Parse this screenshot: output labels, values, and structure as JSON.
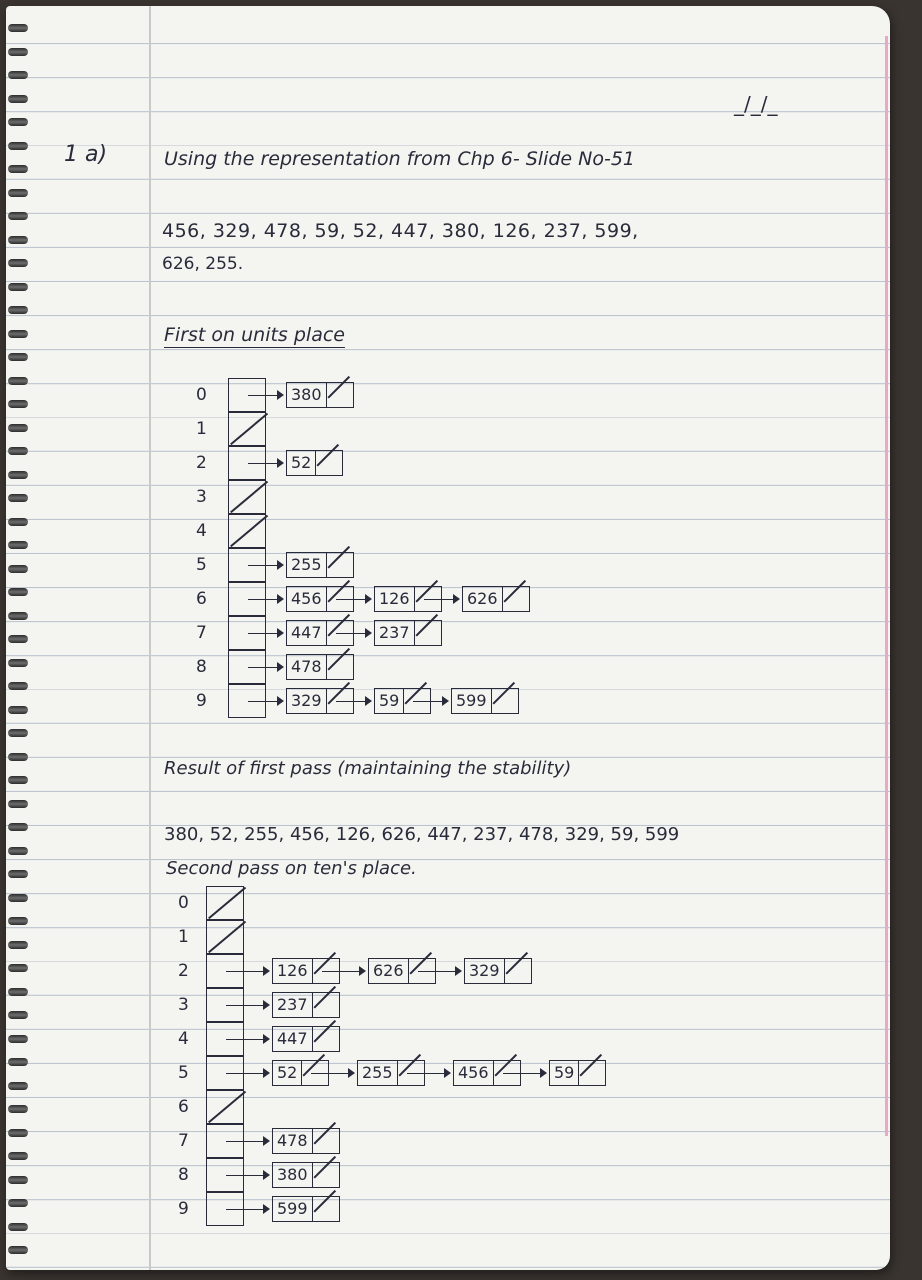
{
  "header": {
    "date_blank": "_/_/_"
  },
  "question": {
    "label": "1 a)",
    "text": "Using the representation from Chp 6- Slide No-51"
  },
  "input_numbers": {
    "line1": "456, 329, 478, 59, 52, 447, 380, 126, 237, 599,",
    "line2": "626, 255."
  },
  "first_pass": {
    "heading": "First on units place",
    "buckets": [
      {
        "index": "0",
        "items": [
          "380"
        ]
      },
      {
        "index": "1",
        "items": []
      },
      {
        "index": "2",
        "items": [
          "52"
        ]
      },
      {
        "index": "3",
        "items": []
      },
      {
        "index": "4",
        "items": []
      },
      {
        "index": "5",
        "items": [
          "255"
        ]
      },
      {
        "index": "6",
        "items": [
          "456",
          "126",
          "626"
        ]
      },
      {
        "index": "7",
        "items": [
          "447",
          "237"
        ]
      },
      {
        "index": "8",
        "items": [
          "478"
        ]
      },
      {
        "index": "9",
        "items": [
          "329",
          "59",
          "599"
        ]
      }
    ]
  },
  "result": {
    "heading": "Result of first pass (maintaining the stability)",
    "values": "380, 52, 255, 456, 126, 626, 447, 237, 478, 329, 59, 599"
  },
  "second_pass": {
    "heading": "Second pass on ten's place.",
    "buckets": [
      {
        "index": "0",
        "items": []
      },
      {
        "index": "1",
        "items": []
      },
      {
        "index": "2",
        "items": [
          "126",
          "626",
          "329"
        ]
      },
      {
        "index": "3",
        "items": [
          "237"
        ]
      },
      {
        "index": "4",
        "items": [
          "447"
        ]
      },
      {
        "index": "5",
        "items": [
          "52",
          "255",
          "456",
          "59"
        ]
      },
      {
        "index": "6",
        "items": []
      },
      {
        "index": "7",
        "items": [
          "478"
        ]
      },
      {
        "index": "8",
        "items": [
          "380"
        ]
      },
      {
        "index": "9",
        "items": [
          "599"
        ]
      }
    ]
  }
}
